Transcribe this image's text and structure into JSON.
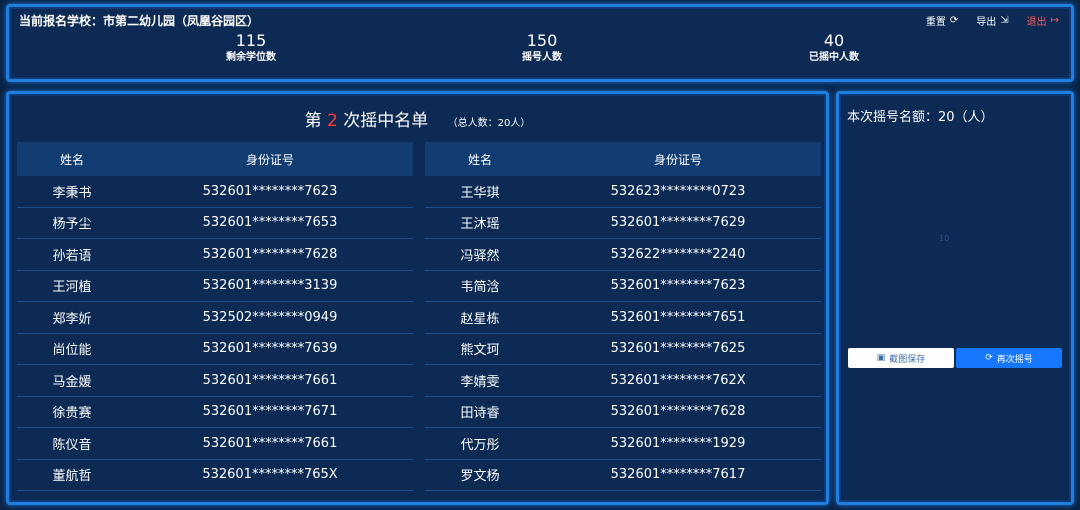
{
  "header": {
    "school_title": "当前报名学校：市第二幼儿园（凤凰谷园区）",
    "actions": {
      "reset": "重置",
      "export": "导出",
      "exit": "退出"
    },
    "stats": [
      {
        "value": "115",
        "label": "剩余学位数"
      },
      {
        "value": "150",
        "label": "摇号人数"
      },
      {
        "value": "40",
        "label": "已摇中人数"
      }
    ]
  },
  "list": {
    "title_prefix": "第",
    "round": "2",
    "title_suffix": "次摇中名单",
    "total": "（总人数：20人）",
    "col_name": "姓名",
    "col_id": "身份证号",
    "left_rows": [
      {
        "name": "李秉书",
        "id": "532601********7623"
      },
      {
        "name": "杨予尘",
        "id": "532601********7653"
      },
      {
        "name": "孙若语",
        "id": "532601********7628"
      },
      {
        "name": "王河植",
        "id": "532601********3139"
      },
      {
        "name": "郑李妡",
        "id": "532502********0949"
      },
      {
        "name": "尚位能",
        "id": "532601********7639"
      },
      {
        "name": "马金媛",
        "id": "532601********7661"
      },
      {
        "name": "徐贵赛",
        "id": "532601********7671"
      },
      {
        "name": "陈仪音",
        "id": "532601********7661"
      },
      {
        "name": "董航哲",
        "id": "532601********765X"
      }
    ],
    "right_rows": [
      {
        "name": "王华琪",
        "id": "532623********0723"
      },
      {
        "name": "王沐瑶",
        "id": "532601********7629"
      },
      {
        "name": "冯驿然",
        "id": "532622********2240"
      },
      {
        "name": "韦简浛",
        "id": "532601********7623"
      },
      {
        "name": "赵星栋",
        "id": "532601********7651"
      },
      {
        "name": "熊文珂",
        "id": "532601********7625"
      },
      {
        "name": "李婧雯",
        "id": "532601********762X"
      },
      {
        "name": "田诗睿",
        "id": "532601********7628"
      },
      {
        "name": "代万彤",
        "id": "532601********1929"
      },
      {
        "name": "罗文杨",
        "id": "532601********7617"
      }
    ]
  },
  "side": {
    "quota": "本次摇号名额：20（人）",
    "placeholder": "10",
    "save_label": "截图保存",
    "again_label": "再次摇号"
  },
  "colors": {
    "accent": "#1677ff",
    "highlight": "#ff3b3b",
    "panel_border": "#1e7fe0",
    "background": "#0a2447"
  }
}
